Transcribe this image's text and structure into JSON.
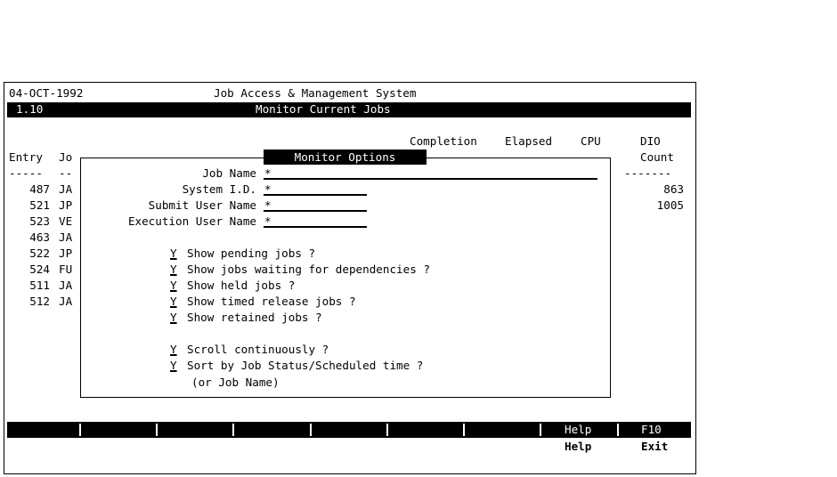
{
  "header": {
    "date": "04-OCT-1992",
    "system_title": "Job Access & Management System",
    "screen_code": "1.10",
    "screen_title": "Monitor Current Jobs"
  },
  "columns": {
    "completion": "Completion",
    "elapsed": "Elapsed",
    "cpu": "CPU",
    "dio": "DIO",
    "entry": "Entry",
    "job": "Jo",
    "count": "Count",
    "entry_dash": "-----",
    "job_dash": "--",
    "count_dash": "-------"
  },
  "rows": [
    {
      "entry": "487",
      "job": "JA",
      "count": "863"
    },
    {
      "entry": "521",
      "job": "JP",
      "count": "1005"
    },
    {
      "entry": "523",
      "job": "VE",
      "count": ""
    },
    {
      "entry": "463",
      "job": "JA",
      "count": ""
    },
    {
      "entry": "522",
      "job": "JP",
      "count": ""
    },
    {
      "entry": "524",
      "job": "FU",
      "count": ""
    },
    {
      "entry": "511",
      "job": "JA",
      "count": ""
    },
    {
      "entry": "512",
      "job": "JA",
      "count": ""
    }
  ],
  "dialog": {
    "title": "Monitor Options",
    "fields": {
      "job_name": {
        "label": "Job Name",
        "value": "*"
      },
      "system_id": {
        "label": "System I.D.",
        "value": "*"
      },
      "submit_user": {
        "label": "Submit User Name",
        "value": "*"
      },
      "exec_user": {
        "label": "Execution User Name",
        "value": "*"
      }
    },
    "options": [
      {
        "flag": "Y",
        "label": "Show pending jobs ?"
      },
      {
        "flag": "Y",
        "label": "Show jobs waiting for dependencies ?"
      },
      {
        "flag": "Y",
        "label": "Show held jobs ?"
      },
      {
        "flag": "Y",
        "label": "Show timed release jobs ?"
      },
      {
        "flag": "Y",
        "label": "Show retained jobs ?"
      },
      {
        "flag": "Y",
        "label": "Scroll continuously ?"
      },
      {
        "flag": "Y",
        "label": "Sort by Job Status/Scheduled time ?"
      }
    ],
    "sort_note": "(or Job Name)"
  },
  "function_keys": {
    "help_key": "Help",
    "f10_key": "F10",
    "help_label": "Help",
    "exit_label": "Exit"
  }
}
